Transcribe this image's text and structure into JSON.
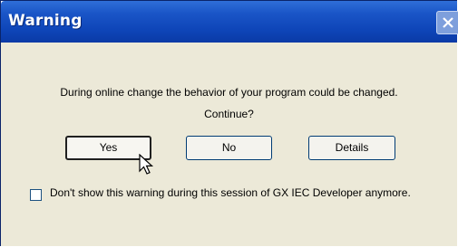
{
  "dialog": {
    "title": "Warning",
    "message": "During online change the behavior of your program could be changed.",
    "question": "Continue?",
    "buttons": {
      "yes": "Yes",
      "no": "No",
      "details": "Details"
    },
    "checkbox": {
      "label": "Don't show this warning during this session of GX IEC Developer anymore.",
      "checked": false
    }
  },
  "icons": {
    "close": "close-icon",
    "cursor": "mouse-pointer-icon"
  },
  "colors": {
    "titlebar": "#0e45b8",
    "body": "#ece9d8",
    "button_face": "#f4f3ee",
    "button_border": "#003c74"
  }
}
